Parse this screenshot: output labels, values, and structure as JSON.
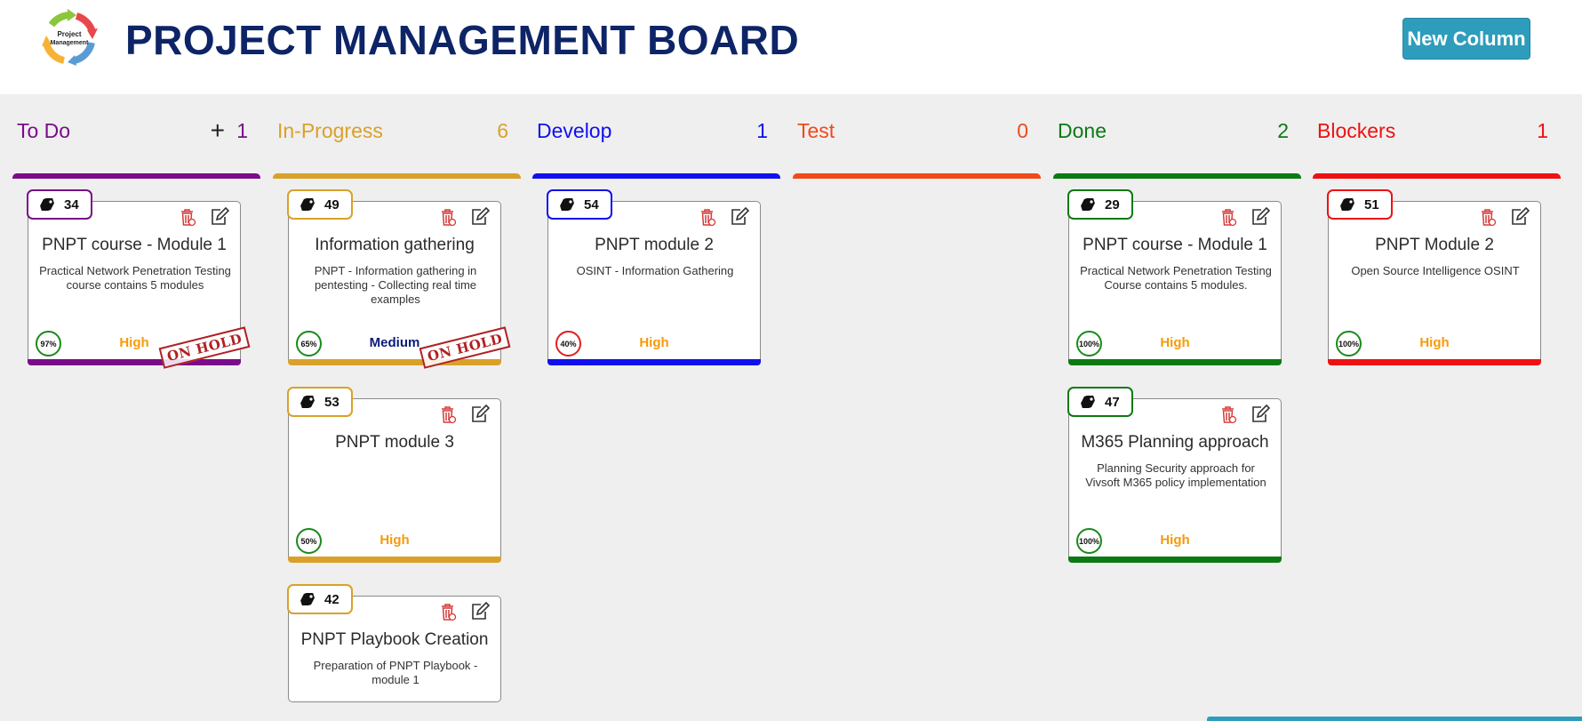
{
  "header": {
    "logo_text_line1": "Project",
    "logo_text_line2": "Management",
    "title": "PROJECT MANAGEMENT BOARD",
    "new_column_label": "New Column"
  },
  "colors": {
    "todo": "#7a0c8a",
    "inprogress": "#d9a12a",
    "develop": "#1010ee",
    "test": "#f04a18",
    "done": "#0b7a12",
    "blockers": "#ee1111",
    "priority_high": "#f59a0c",
    "priority_medium": "#0a1a7a",
    "progress_green": "#1a8a1a",
    "progress_red": "#e02020"
  },
  "columns": [
    {
      "title": "To Do",
      "count": "1",
      "has_add": true,
      "cards": [
        {
          "id": "34",
          "title": "PNPT course - Module 1",
          "description": "Practical Network Penetration Testing course contains 5 modules",
          "progress": "97%",
          "priority": "High",
          "on_hold": true,
          "stamp": "ON HOLD"
        }
      ]
    },
    {
      "title": "In-Progress",
      "count": "6",
      "cards": [
        {
          "id": "49",
          "title": "Information gathering",
          "description": "PNPT - Information gathering in pentesting - Collecting real time examples",
          "progress": "65%",
          "priority": "Medium",
          "on_hold": true,
          "stamp": "ON HOLD"
        },
        {
          "id": "53",
          "title": "PNPT module 3",
          "description": "",
          "progress": "50%",
          "priority": "High"
        },
        {
          "id": "42",
          "title": "PNPT Playbook Creation",
          "description": "Preparation of PNPT Playbook - module 1",
          "progress": "",
          "priority": ""
        }
      ]
    },
    {
      "title": "Develop",
      "count": "1",
      "cards": [
        {
          "id": "54",
          "title": "PNPT module 2",
          "description": "OSINT - Information Gathering",
          "progress": "40%",
          "priority": "High"
        }
      ]
    },
    {
      "title": "Test",
      "count": "0",
      "cards": []
    },
    {
      "title": "Done",
      "count": "2",
      "cards": [
        {
          "id": "29",
          "title": "PNPT course - Module 1",
          "description": "Practical Network Penetration Testing Course  contains 5 modules.",
          "progress": "100%",
          "priority": "High"
        },
        {
          "id": "47",
          "title": "M365 Planning approach",
          "description": "Planning Security approach for Vivsoft M365 policy implementation",
          "progress": "100%",
          "priority": "High"
        }
      ]
    },
    {
      "title": "Blockers",
      "count": "1",
      "cards": [
        {
          "id": "51",
          "title": "PNPT Module 2",
          "description": "Open Source Intelligence OSINT",
          "progress": "100%",
          "priority": "High"
        }
      ]
    }
  ]
}
